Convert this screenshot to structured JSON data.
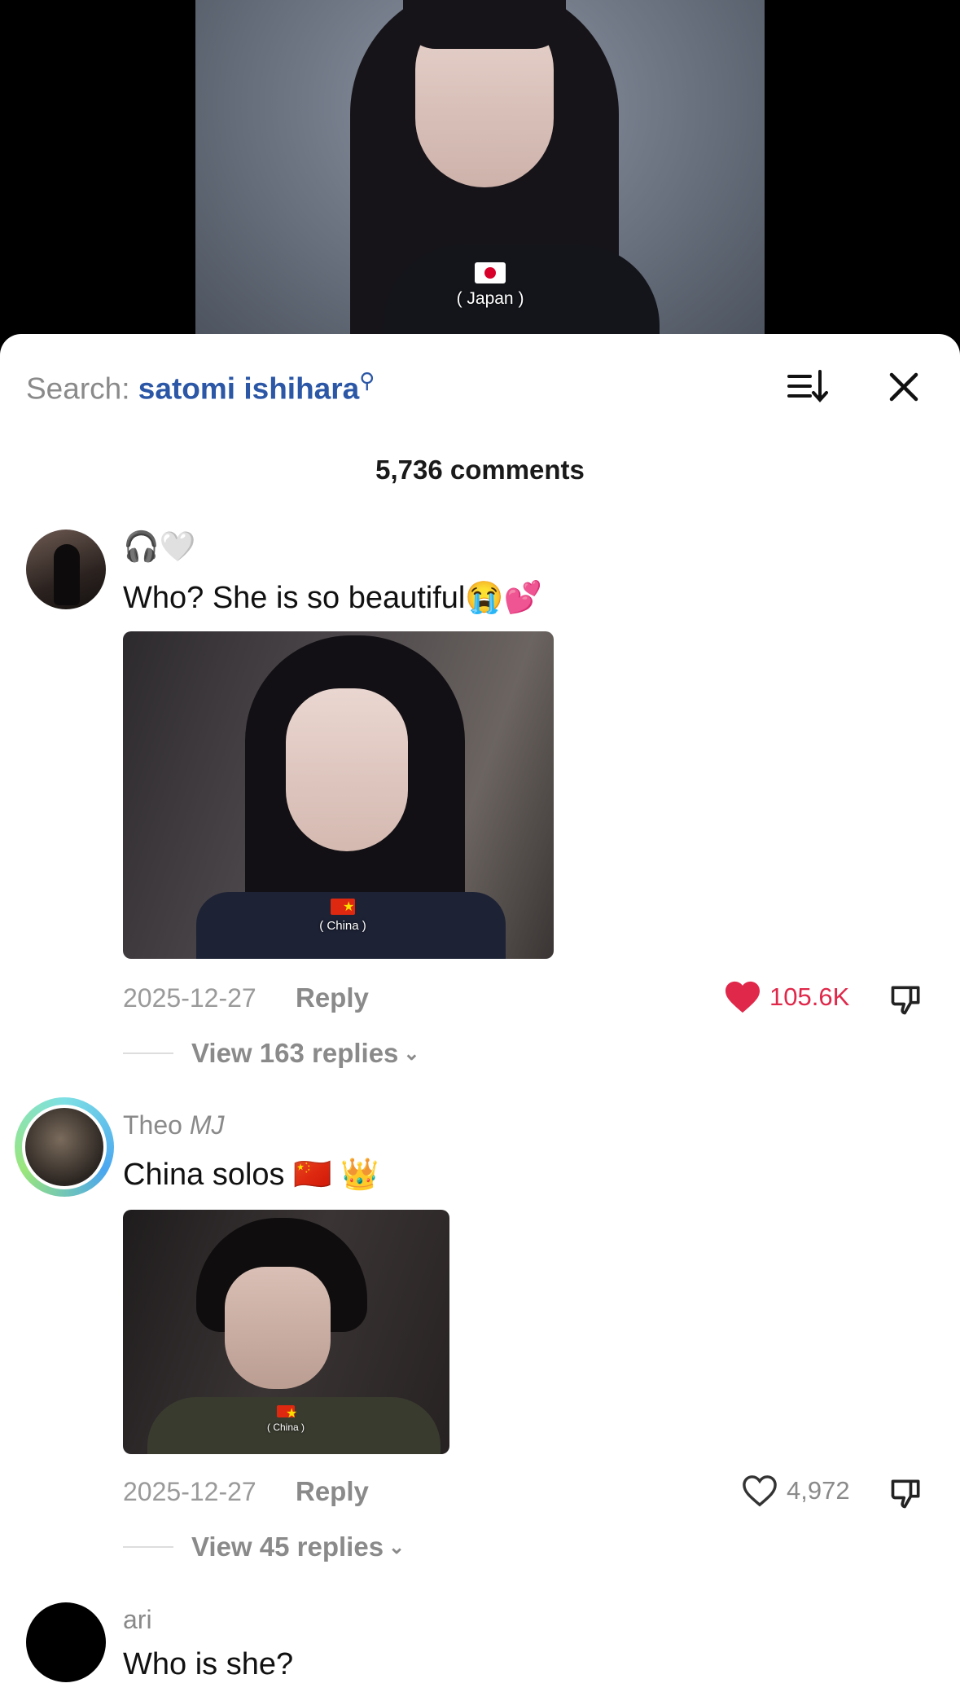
{
  "video": {
    "flag_caption": "( Japan )"
  },
  "header": {
    "search_prefix": "Search:",
    "search_query": "satomi ishihara",
    "comment_count": "5,736 comments"
  },
  "comments": [
    {
      "username": "",
      "badges": "🎧🤍",
      "text": "Who? She is so beautiful😭💕",
      "image_caption": "( China )",
      "date": "2025-12-27",
      "reply_label": "Reply",
      "likes": "105.6K",
      "liked": true,
      "view_replies": "View 163 replies"
    },
    {
      "username": "Theo",
      "username_suffix": "MJ",
      "text": "China solos 🇨🇳 👑",
      "image_caption": "( China )",
      "date": "2025-12-27",
      "reply_label": "Reply",
      "likes": "4,972",
      "liked": false,
      "view_replies": "View 45 replies"
    },
    {
      "username": "ari",
      "text": "Who is she?"
    }
  ],
  "colors": {
    "like_red": "#e0284a",
    "query_blue": "#2b57a6"
  }
}
